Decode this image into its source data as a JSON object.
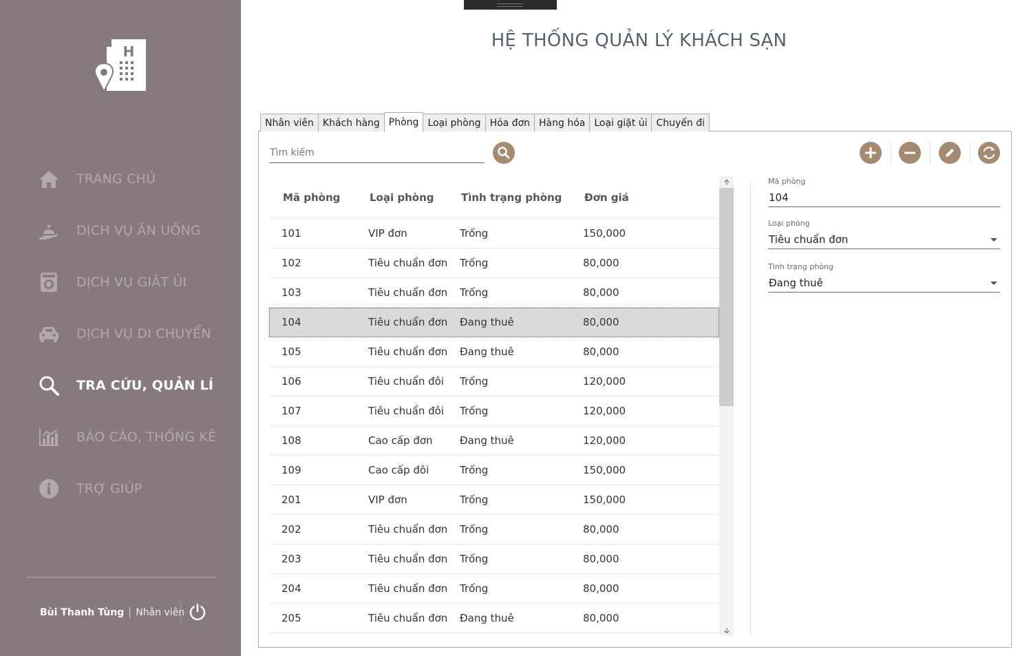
{
  "app": {
    "title": "HỆ THỐNG QUẢN LÝ KHÁCH SẠN",
    "accent_color": "#a38a71",
    "sidebar_color": "#867a80"
  },
  "sidebar": {
    "logo_icon": "hotel-location-icon",
    "items": [
      {
        "label": "TRANG CHỦ",
        "icon": "home-icon",
        "active": false
      },
      {
        "label": "DỊCH VỤ ĂN UỐNG",
        "icon": "room-service-icon",
        "active": false
      },
      {
        "label": "DỊCH VỤ GIẶT ỦI",
        "icon": "washing-machine-icon",
        "active": false
      },
      {
        "label": "DỊCH VỤ DI CHUYỂN",
        "icon": "car-icon",
        "active": false
      },
      {
        "label": "TRA CỨU, QUẢN LÍ",
        "icon": "search-icon",
        "active": true
      },
      {
        "label": "BÁO CÁO, THỐNG KÊ",
        "icon": "chart-icon",
        "active": false
      },
      {
        "label": "TRỢ GIÚP",
        "icon": "info-icon",
        "active": false
      }
    ],
    "user": {
      "name": "Bùi Thanh Tùng",
      "role": "Nhân viên"
    }
  },
  "tabs": [
    {
      "label": "Nhân viên",
      "active": false
    },
    {
      "label": "Khách hàng",
      "active": false
    },
    {
      "label": "Phòng",
      "active": true
    },
    {
      "label": "Loại phòng",
      "active": false
    },
    {
      "label": "Hóa đơn",
      "active": false
    },
    {
      "label": "Hàng hóa",
      "active": false
    },
    {
      "label": "Loại giặt ủi",
      "active": false
    },
    {
      "label": "Chuyến đi",
      "active": false
    }
  ],
  "search": {
    "placeholder": "Tìm kiếm",
    "value": ""
  },
  "actions": [
    {
      "name": "add",
      "icon": "plus-icon"
    },
    {
      "name": "delete",
      "icon": "minus-icon"
    },
    {
      "name": "edit",
      "icon": "pencil-icon"
    },
    {
      "name": "refresh",
      "icon": "refresh-icon"
    }
  ],
  "table": {
    "columns": [
      "Mã phòng",
      "Loại phòng",
      "Tình trạng phòng",
      "Đơn giá"
    ],
    "selected_row": 3,
    "rows": [
      [
        "101",
        "VIP đơn",
        "Trống",
        "150,000"
      ],
      [
        "102",
        "Tiêu chuẩn đơn",
        "Trống",
        "80,000"
      ],
      [
        "103",
        "Tiêu chuẩn đơn",
        "Trống",
        "80,000"
      ],
      [
        "104",
        "Tiêu chuẩn đơn",
        "Đang thuê",
        "80,000"
      ],
      [
        "105",
        "Tiêu chuẩn đơn",
        "Đang thuê",
        "80,000"
      ],
      [
        "106",
        "Tiêu chuẩn đôi",
        "Trống",
        "120,000"
      ],
      [
        "107",
        "Tiêu chuẩn đôi",
        "Trống",
        "120,000"
      ],
      [
        "108",
        "Cao cấp đơn",
        "Đang thuê",
        "120,000"
      ],
      [
        "109",
        "Cao cấp đôi",
        "Trống",
        "150,000"
      ],
      [
        "201",
        "VIP đơn",
        "Trống",
        "150,000"
      ],
      [
        "202",
        "Tiêu chuẩn đơn",
        "Trống",
        "80,000"
      ],
      [
        "203",
        "Tiêu chuẩn đơn",
        "Trống",
        "80,000"
      ],
      [
        "204",
        "Tiêu chuẩn đơn",
        "Trống",
        "80,000"
      ],
      [
        "205",
        "Tiêu chuẩn đơn",
        "Đang thuê",
        "80,000"
      ]
    ]
  },
  "detail": {
    "ma_phong_label": "Mã phòng",
    "ma_phong_value": "104",
    "loai_phong_label": "Loại phòng",
    "loai_phong_value": "Tiêu chuẩn đơn",
    "tinh_trang_label": "Tình trạng phòng",
    "tinh_trang_value": "Đang thuê"
  }
}
